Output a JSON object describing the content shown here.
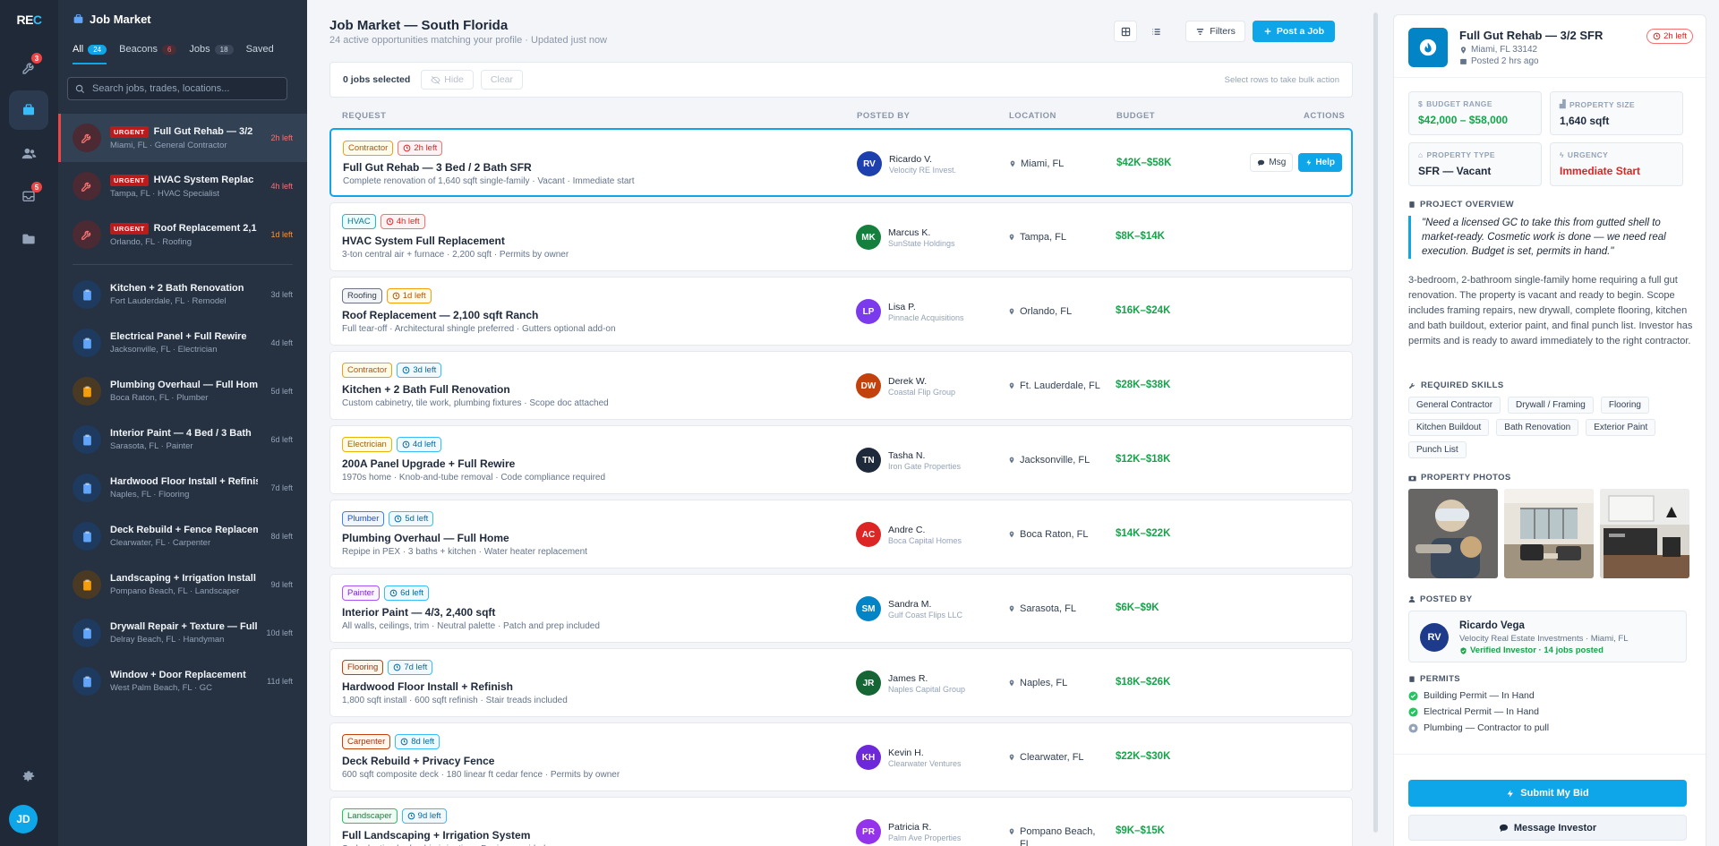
{
  "brand": {
    "logo": "RE",
    "logo_accent": "C"
  },
  "rail": {
    "badges": {
      "tools": "3",
      "inbox": "5"
    },
    "avatar": "JD"
  },
  "panel": {
    "title": "Job Market",
    "tabs": [
      {
        "label": "All",
        "count": "24"
      },
      {
        "label": "Beacons",
        "count": "6"
      },
      {
        "label": "Jobs",
        "count": "18"
      },
      {
        "label": "Saved",
        "count": ""
      }
    ],
    "search_placeholder": "Search jobs, trades, locations...",
    "urgent_label": "URGENT",
    "urgent_items": [
      {
        "title": "Full Gut Rehab — 3/2",
        "sub": "Miami, FL · General Contractor",
        "time": "2h left"
      },
      {
        "title": "HVAC System Replac",
        "sub": "Tampa, FL · HVAC Specialist",
        "time": "4h left"
      },
      {
        "title": "Roof Replacement 2,1",
        "sub": "Orlando, FL · Roofing",
        "time": "1d left"
      }
    ],
    "items": [
      {
        "title": "Kitchen + 2 Bath Renovation",
        "sub": "Fort Lauderdale, FL · Remodel",
        "time": "3d left",
        "color": "blue"
      },
      {
        "title": "Electrical Panel + Full Rewire",
        "sub": "Jacksonville, FL · Electrician",
        "time": "4d left",
        "color": "blue"
      },
      {
        "title": "Plumbing Overhaul — Full Home",
        "sub": "Boca Raton, FL · Plumber",
        "time": "5d left",
        "color": "amber"
      },
      {
        "title": "Interior Paint — 4 Bed / 3 Bath",
        "sub": "Sarasota, FL · Painter",
        "time": "6d left",
        "color": "blue"
      },
      {
        "title": "Hardwood Floor Install + Refinish",
        "sub": "Naples, FL · Flooring",
        "time": "7d left",
        "color": "blue"
      },
      {
        "title": "Deck Rebuild + Fence Replacement",
        "sub": "Clearwater, FL · Carpenter",
        "time": "8d left",
        "color": "blue"
      },
      {
        "title": "Landscaping + Irrigation Install",
        "sub": "Pompano Beach, FL · Landscaper",
        "time": "9d left",
        "color": "amber"
      },
      {
        "title": "Drywall Repair + Texture — Full",
        "sub": "Delray Beach, FL · Handyman",
        "time": "10d left",
        "color": "blue"
      },
      {
        "title": "Window + Door Replacement",
        "sub": "West Palm Beach, FL · GC",
        "time": "11d left",
        "color": "blue"
      }
    ]
  },
  "main": {
    "title": "Job Market — South Florida",
    "subtitle": "24 active opportunities matching your profile · Updated just now",
    "filters_label": "Filters",
    "post_label": "Post a Job",
    "bulk": {
      "selected": "0 jobs selected",
      "hide": "Hide",
      "clear": "Clear",
      "hint": "Select rows to take bulk action"
    },
    "columns": {
      "request": "REQUEST",
      "posted_by": "POSTED BY",
      "location": "LOCATION",
      "budget": "BUDGET",
      "actions": "ACTIONS"
    },
    "msg_label": "Msg",
    "help_label": "Help",
    "rows": [
      {
        "trade": "Contractor",
        "trade_style": "amber",
        "time": "2h left",
        "time_style": "red",
        "title": "Full Gut Rehab — 3 Bed / 2 Bath SFR",
        "desc": "Complete renovation of 1,640 sqft single-family · Vacant · Immediate start",
        "initials": "RV",
        "avatar_color": "#1e40af",
        "poster": "Ricardo V.",
        "company": "Velocity RE Invest.",
        "location": "Miami, FL",
        "budget": "$42K–$58K"
      },
      {
        "trade": "HVAC",
        "trade_style": "teal",
        "time": "4h left",
        "time_style": "red",
        "title": "HVAC System Full Replacement",
        "desc": "3-ton central air + furnace · 2,200 sqft · Permits by owner",
        "initials": "MK",
        "avatar_color": "#15803d",
        "poster": "Marcus K.",
        "company": "SunState Holdings",
        "location": "Tampa, FL",
        "budget": "$8K–$14K"
      },
      {
        "trade": "Roofing",
        "trade_style": "gray",
        "time": "1d left",
        "time_style": "amber",
        "title": "Roof Replacement — 2,100 sqft Ranch",
        "desc": "Full tear-off · Architectural shingle preferred · Gutters optional add-on",
        "initials": "LP",
        "avatar_color": "#7c3aed",
        "poster": "Lisa P.",
        "company": "Pinnacle Acquisitions",
        "location": "Orlando, FL",
        "budget": "$16K–$24K"
      },
      {
        "trade": "Contractor",
        "trade_style": "amber",
        "time": "3d left",
        "time_style": "cyan",
        "title": "Kitchen + 2 Bath Full Renovation",
        "desc": "Custom cabinetry, tile work, plumbing fixtures · Scope doc attached",
        "initials": "DW",
        "avatar_color": "#c2410c",
        "poster": "Derek W.",
        "company": "Coastal Flip Group",
        "location": "Ft. Lauderdale, FL",
        "budget": "$28K–$38K"
      },
      {
        "trade": "Electrician",
        "trade_style": "yellow",
        "time": "4d left",
        "time_style": "cyan",
        "title": "200A Panel Upgrade + Full Rewire",
        "desc": "1970s home · Knob-and-tube removal · Code compliance required",
        "initials": "TN",
        "avatar_color": "#1e293b",
        "poster": "Tasha N.",
        "company": "Iron Gate Properties",
        "location": "Jacksonville, FL",
        "budget": "$12K–$18K"
      },
      {
        "trade": "Plumber",
        "trade_style": "blue",
        "time": "5d left",
        "time_style": "cyan",
        "title": "Plumbing Overhaul — Full Home",
        "desc": "Repipe in PEX · 3 baths + kitchen · Water heater replacement",
        "initials": "AC",
        "avatar_color": "#dc2626",
        "poster": "Andre C.",
        "company": "Boca Capital Homes",
        "location": "Boca Raton, FL",
        "budget": "$14K–$22K"
      },
      {
        "trade": "Painter",
        "trade_style": "purple",
        "time": "6d left",
        "time_style": "cyan",
        "title": "Interior Paint — 4/3, 2,400 sqft",
        "desc": "All walls, ceilings, trim · Neutral palette · Patch and prep included",
        "initials": "SM",
        "avatar_color": "#0284c7",
        "poster": "Sandra M.",
        "company": "Gulf Coast Flips LLC",
        "location": "Sarasota, FL",
        "budget": "$6K–$9K"
      },
      {
        "trade": "Flooring",
        "trade_style": "brown",
        "time": "7d left",
        "time_style": "cyan",
        "title": "Hardwood Floor Install + Refinish",
        "desc": "1,800 sqft install · 600 sqft refinish · Stair treads included",
        "initials": "JR",
        "avatar_color": "#166534",
        "poster": "James R.",
        "company": "Naples Capital Group",
        "location": "Naples, FL",
        "budget": "$18K–$26K"
      },
      {
        "trade": "Carpenter",
        "trade_style": "brown",
        "time": "8d left",
        "time_style": "cyan",
        "title": "Deck Rebuild + Privacy Fence",
        "desc": "600 sqft composite deck · 180 linear ft cedar fence · Permits by owner",
        "initials": "KH",
        "avatar_color": "#6d28d9",
        "poster": "Kevin H.",
        "company": "Clearwater Ventures",
        "location": "Clearwater, FL",
        "budget": "$22K–$30K"
      },
      {
        "trade": "Landscaper",
        "trade_style": "green",
        "time": "9d left",
        "time_style": "cyan",
        "title": "Full Landscaping + Irrigation System",
        "desc": "Sod, planting beds, drip irrigation · Design provided",
        "initials": "PR",
        "avatar_color": "#9333ea",
        "poster": "Patricia R.",
        "company": "Palm Ave Properties",
        "location": "Pompano Beach, FL",
        "budget": "$9K–$15K"
      }
    ]
  },
  "detail": {
    "title": "Full Gut Rehab — 3/2 SFR",
    "location": "Miami, FL 33142",
    "posted": "Posted 2 hrs ago",
    "time_left": "2h left",
    "stats": [
      {
        "label": "BUDGET RANGE",
        "value": "$42,000 – $58,000"
      },
      {
        "label": "PROPERTY SIZE",
        "value": "1,640 sqft"
      },
      {
        "label": "PROPERTY TYPE",
        "value": "SFR — Vacant"
      },
      {
        "label": "URGENCY",
        "value": "Immediate Start"
      }
    ],
    "overview_heading": "PROJECT OVERVIEW",
    "quote": "\"Need a licensed GC to take this from gutted shell to market-ready. Cosmetic work is done — we need real execution. Budget is set, permits in hand.\"",
    "description": "3-bedroom, 2-bathroom single-family home requiring a full gut renovation. The property is vacant and ready to begin. Scope includes framing repairs, new drywall, complete flooring, kitchen and bath buildout, exterior paint, and final punch list. Investor has permits and is ready to award immediately to the right contractor.",
    "skills_heading": "REQUIRED SKILLS",
    "skills": [
      "General Contractor",
      "Drywall / Framing",
      "Flooring",
      "Kitchen Buildout",
      "Bath Renovation",
      "Exterior Paint",
      "Punch List"
    ],
    "photos_heading": "PROPERTY PHOTOS",
    "posted_by_heading": "POSTED BY",
    "poster": {
      "initials": "RV",
      "name": "Ricardo Vega",
      "company": "Velocity Real Estate Investments · Miami, FL",
      "verified": "Verified Investor · 14 jobs posted"
    },
    "permits_heading": "PERMITS",
    "permits": [
      {
        "label": "Building Permit — In Hand",
        "status": "done"
      },
      {
        "label": "Electrical Permit — In Hand",
        "status": "done"
      },
      {
        "label": "Plumbing — Contractor to pull",
        "status": "pending"
      }
    ],
    "submit_label": "Submit My Bid",
    "message_label": "Message Investor"
  },
  "colors": {
    "accent": "#0ea5e9",
    "danger": "#dc2626",
    "success": "#16a34a",
    "sidebar": "#1f2937"
  }
}
